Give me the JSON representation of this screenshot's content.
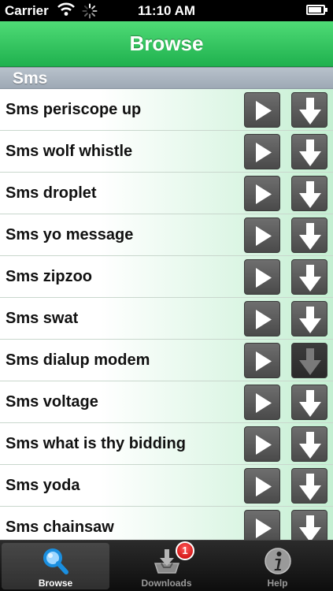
{
  "status_bar": {
    "carrier": "Carrier",
    "time": "11:10 AM",
    "wifi_icon": "wifi-icon",
    "spinner_icon": "activity-spinner-icon",
    "battery_icon": "battery-icon"
  },
  "nav": {
    "title": "Browse"
  },
  "section": {
    "title": "Sms"
  },
  "items": [
    {
      "label": "Sms periscope up"
    },
    {
      "label": "Sms wolf whistle"
    },
    {
      "label": "Sms droplet"
    },
    {
      "label": "Sms yo message"
    },
    {
      "label": "Sms zipzoo"
    },
    {
      "label": "Sms swat"
    },
    {
      "label": "Sms dialup modem"
    },
    {
      "label": "Sms voltage"
    },
    {
      "label": "Sms what is thy bidding"
    },
    {
      "label": "Sms yoda"
    },
    {
      "label": "Sms chainsaw"
    }
  ],
  "tabs": [
    {
      "label": "Browse",
      "icon": "search-icon",
      "selected": true
    },
    {
      "label": "Downloads",
      "icon": "download-tray-icon",
      "badge": "1"
    },
    {
      "label": "Help",
      "icon": "info-icon"
    }
  ],
  "colors": {
    "nav_green": "#1fb14e",
    "row_gradient_end": "#c4efd2",
    "button_gray": "#5a5a5a",
    "badge_red": "#c40000"
  }
}
